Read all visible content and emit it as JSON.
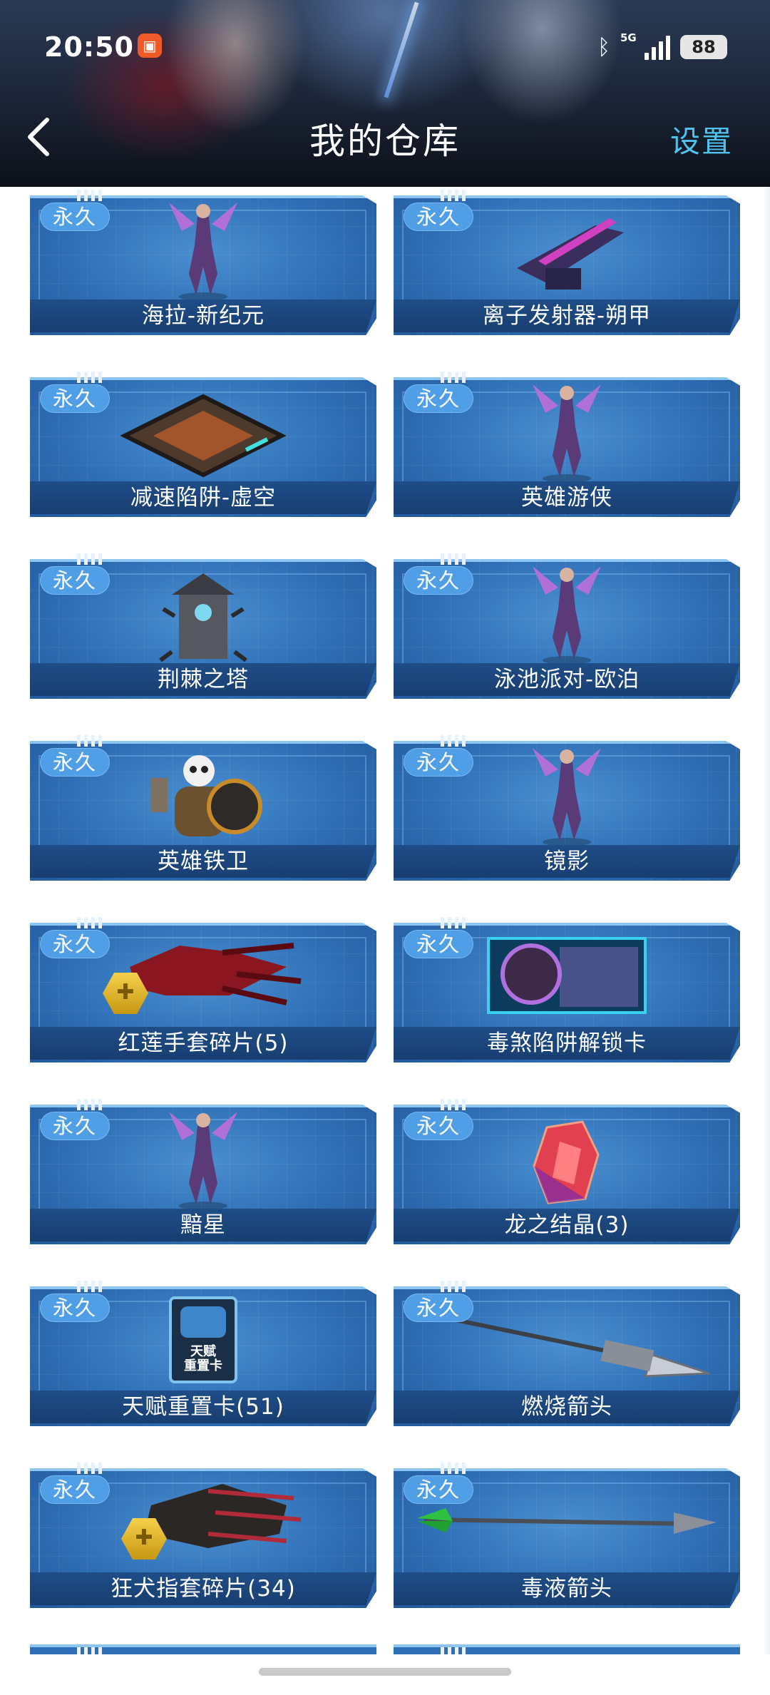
{
  "status_bar": {
    "time": "20:50",
    "network": "5G",
    "battery": "88",
    "icons": [
      "app-notification-icon",
      "bluetooth-icon",
      "signal-icon",
      "battery-icon"
    ]
  },
  "header": {
    "title": "我的仓库",
    "settings_label": "设置",
    "back_icon": "chevron-left-icon"
  },
  "badge_label": "永久",
  "items": [
    {
      "name": "海拉-新纪元",
      "visual": "hero"
    },
    {
      "name": "离子发射器-朔甲",
      "visual": "turret"
    },
    {
      "name": "减速陷阱-虚空",
      "visual": "trap"
    },
    {
      "name": "英雄游侠",
      "visual": "hero"
    },
    {
      "name": "荆棘之塔",
      "visual": "tower"
    },
    {
      "name": "泳池派对-欧泊",
      "visual": "hero"
    },
    {
      "name": "英雄铁卫",
      "visual": "guard"
    },
    {
      "name": "镜影",
      "visual": "hero"
    },
    {
      "name": "红莲手套碎片(5)",
      "visual": "gauntlet-fragment"
    },
    {
      "name": "毒煞陷阱解锁卡",
      "visual": "card"
    },
    {
      "name": "黯星",
      "visual": "hero"
    },
    {
      "name": "龙之结晶(3)",
      "visual": "crystal"
    },
    {
      "name": "天赋重置卡(51)",
      "visual": "reset-card",
      "card_text": "天赋\n重置卡"
    },
    {
      "name": "燃烧箭头",
      "visual": "arrow"
    },
    {
      "name": "狂犬指套碎片(34)",
      "visual": "claw-fragment"
    },
    {
      "name": "毒液箭头",
      "visual": "arrow-green"
    }
  ],
  "colors": {
    "accent": "#4fc3f0",
    "card_blue": "#2f6fb6",
    "badge_blue": "#4f9ee6",
    "name_bar": "#1b4479"
  }
}
